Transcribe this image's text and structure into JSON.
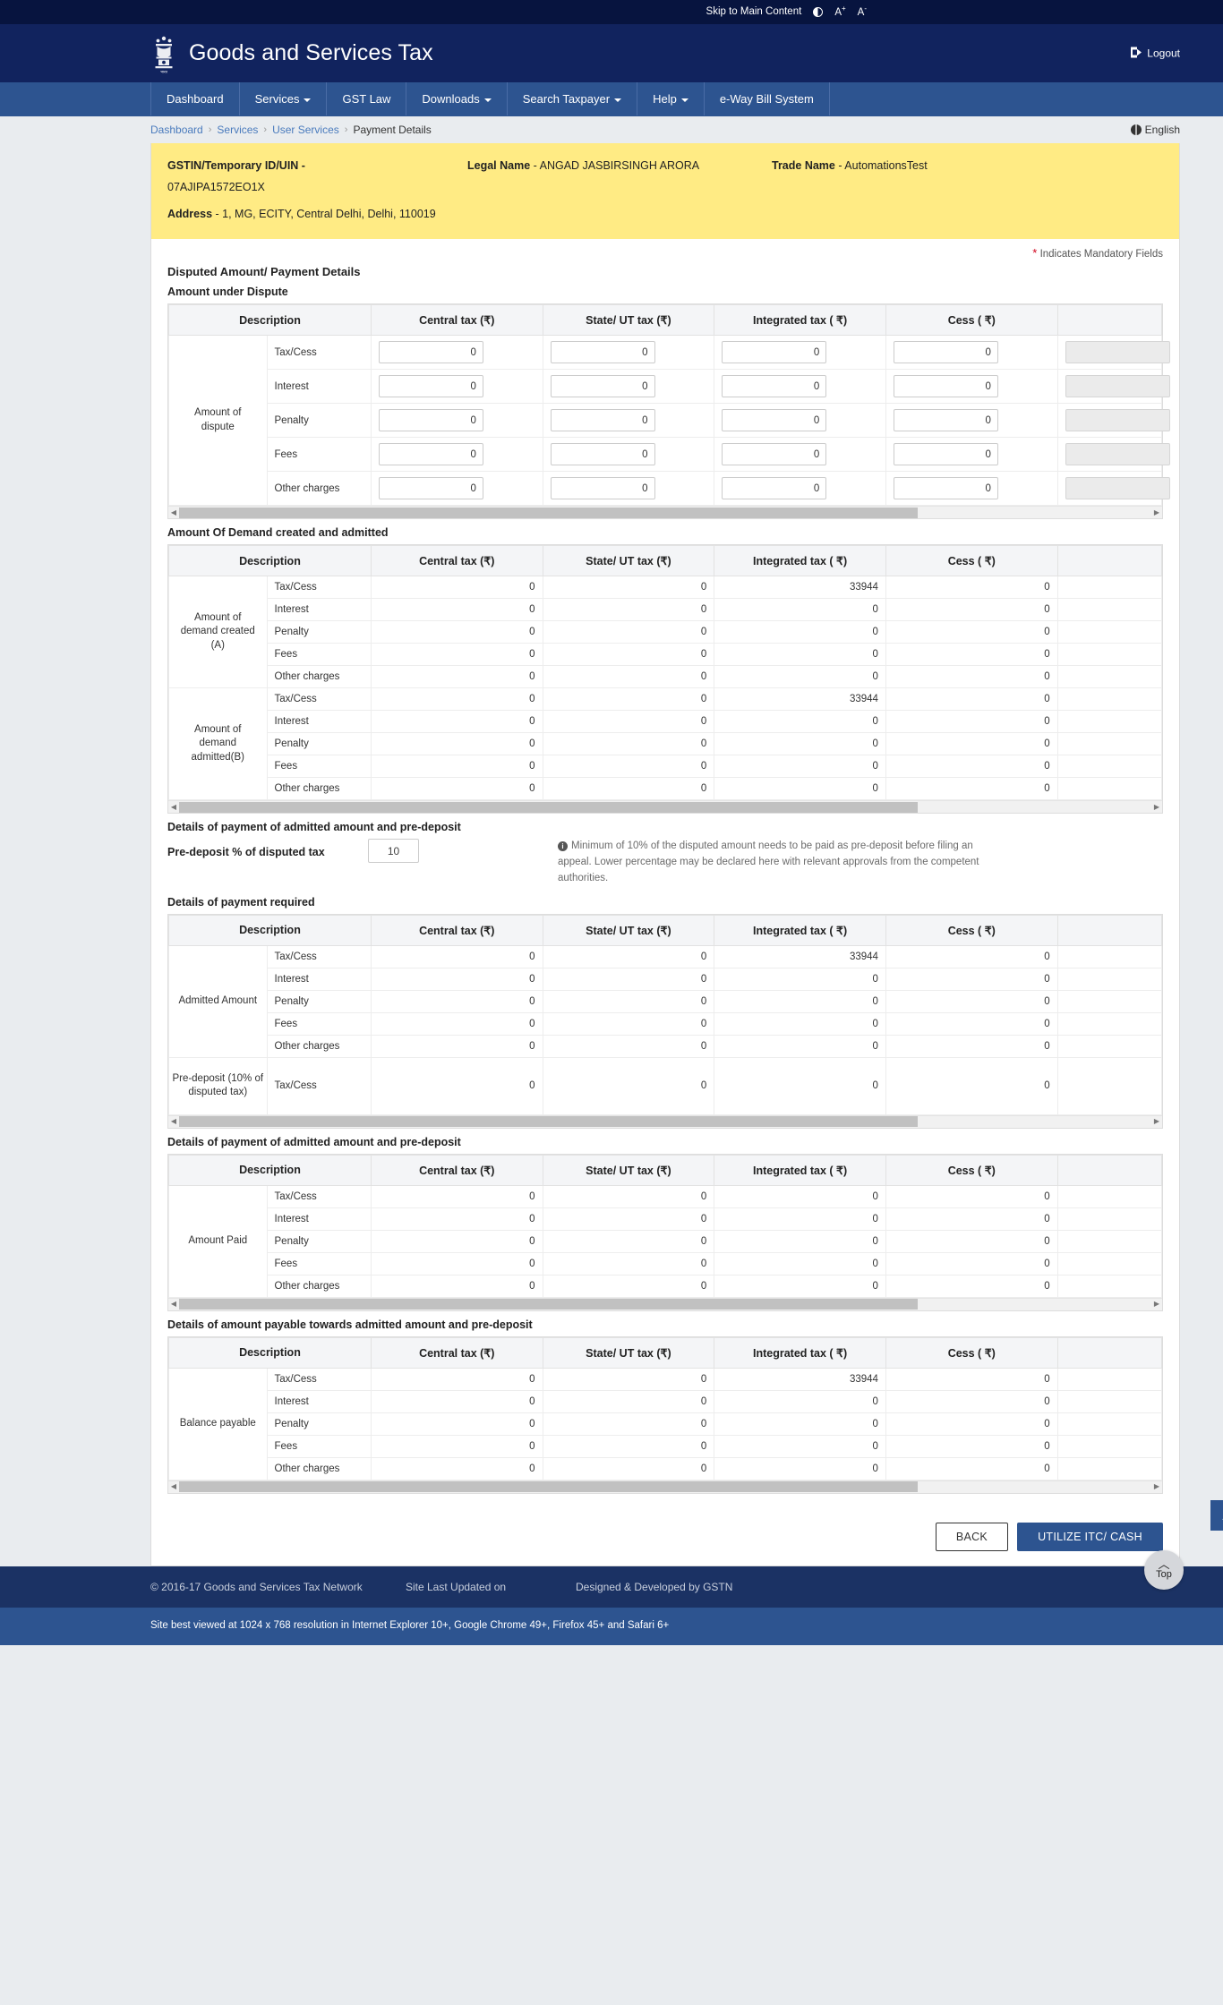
{
  "utilbar": {
    "skip": "Skip to Main Content",
    "contrast_icon": "contrast-icon",
    "font_increase": "A",
    "font_increase_sup": "+",
    "font_decrease": "A",
    "font_decrease_sup": "-"
  },
  "header": {
    "title": "Goods and Services Tax",
    "logout": "Logout",
    "emblem_icon": "india-emblem-icon"
  },
  "nav": {
    "items": [
      {
        "label": "Dashboard",
        "has_caret": false
      },
      {
        "label": "Services",
        "has_caret": true
      },
      {
        "label": "GST Law",
        "has_caret": false
      },
      {
        "label": "Downloads",
        "has_caret": true
      },
      {
        "label": "Search Taxpayer",
        "has_caret": true
      },
      {
        "label": "Help",
        "has_caret": true
      },
      {
        "label": "e-Way Bill System",
        "has_caret": false
      }
    ]
  },
  "breadcrumb": {
    "items": [
      "Dashboard",
      "Services",
      "User Services",
      "Payment Details"
    ],
    "separator": "›",
    "language": "English"
  },
  "taxpayer": {
    "gstin_label": "GSTIN/Temporary ID/UIN -",
    "gstin_value": "07AJIPA1572EO1X",
    "legal_name_label": "Legal Name",
    "legal_name_value": "- ANGAD JASBIRSINGH ARORA",
    "trade_name_label": "Trade Name",
    "trade_name_value": "- AutomationsTest",
    "address_label": "Address",
    "address_value": "- 1, MG, ECITY, Central Delhi, Delhi, 110019"
  },
  "mandatory_note": "Indicates Mandatory Fields",
  "page_title": "Disputed Amount/ Payment Details",
  "columns": [
    "Description",
    "Central tax (₹)",
    "State/ UT tax (₹)",
    "Integrated tax ( ₹)",
    "Cess ( ₹)",
    ""
  ],
  "row_labels": [
    "Tax/Cess",
    "Interest",
    "Penalty",
    "Fees",
    "Other charges"
  ],
  "table1": {
    "title": "Amount under Dispute",
    "group_label": "Amount of dispute",
    "editable": true,
    "rows": [
      {
        "label": "Tax/Cess",
        "values": [
          "0",
          "0",
          "0",
          "0"
        ]
      },
      {
        "label": "Interest",
        "values": [
          "0",
          "0",
          "0",
          "0"
        ]
      },
      {
        "label": "Penalty",
        "values": [
          "0",
          "0",
          "0",
          "0"
        ]
      },
      {
        "label": "Fees",
        "values": [
          "0",
          "0",
          "0",
          "0"
        ]
      },
      {
        "label": "Other charges",
        "values": [
          "0",
          "0",
          "0",
          "0"
        ]
      }
    ]
  },
  "table2": {
    "title": "Amount Of Demand created and admitted",
    "groups": [
      {
        "label": "Amount of demand created (A)",
        "rows": [
          {
            "label": "Tax/Cess",
            "values": [
              "0",
              "0",
              "33944",
              "0"
            ]
          },
          {
            "label": "Interest",
            "values": [
              "0",
              "0",
              "0",
              "0"
            ]
          },
          {
            "label": "Penalty",
            "values": [
              "0",
              "0",
              "0",
              "0"
            ]
          },
          {
            "label": "Fees",
            "values": [
              "0",
              "0",
              "0",
              "0"
            ]
          },
          {
            "label": "Other charges",
            "values": [
              "0",
              "0",
              "0",
              "0"
            ]
          }
        ]
      },
      {
        "label": "Amount of demand admitted(B)",
        "rows": [
          {
            "label": "Tax/Cess",
            "values": [
              "0",
              "0",
              "33944",
              "0"
            ]
          },
          {
            "label": "Interest",
            "values": [
              "0",
              "0",
              "0",
              "0"
            ]
          },
          {
            "label": "Penalty",
            "values": [
              "0",
              "0",
              "0",
              "0"
            ]
          },
          {
            "label": "Fees",
            "values": [
              "0",
              "0",
              "0",
              "0"
            ]
          },
          {
            "label": "Other charges",
            "values": [
              "0",
              "0",
              "0",
              "0"
            ]
          }
        ]
      }
    ]
  },
  "predeposit": {
    "section_title": "Details of payment of admitted amount and pre-deposit",
    "label": "Pre-deposit % of disputed tax",
    "value": "10",
    "note": "Minimum of 10% of the disputed amount needs to be paid as pre-deposit before filing an appeal. Lower percentage may be declared here with relevant approvals from the competent authorities."
  },
  "table3": {
    "title": "Details of payment required",
    "groups": [
      {
        "label": "Admitted Amount",
        "rows": [
          {
            "label": "Tax/Cess",
            "values": [
              "0",
              "0",
              "33944",
              "0"
            ]
          },
          {
            "label": "Interest",
            "values": [
              "0",
              "0",
              "0",
              "0"
            ]
          },
          {
            "label": "Penalty",
            "values": [
              "0",
              "0",
              "0",
              "0"
            ]
          },
          {
            "label": "Fees",
            "values": [
              "0",
              "0",
              "0",
              "0"
            ]
          },
          {
            "label": "Other charges",
            "values": [
              "0",
              "0",
              "0",
              "0"
            ]
          }
        ]
      },
      {
        "label": "Pre-deposit (10% of disputed tax)",
        "rows": [
          {
            "label": "Tax/Cess",
            "values": [
              "0",
              "0",
              "0",
              "0"
            ]
          }
        ]
      }
    ]
  },
  "table4": {
    "title": "Details of payment of admitted amount and pre-deposit",
    "groups": [
      {
        "label": "Amount Paid",
        "rows": [
          {
            "label": "Tax/Cess",
            "values": [
              "0",
              "0",
              "0",
              "0"
            ]
          },
          {
            "label": "Interest",
            "values": [
              "0",
              "0",
              "0",
              "0"
            ]
          },
          {
            "label": "Penalty",
            "values": [
              "0",
              "0",
              "0",
              "0"
            ]
          },
          {
            "label": "Fees",
            "values": [
              "0",
              "0",
              "0",
              "0"
            ]
          },
          {
            "label": "Other charges",
            "values": [
              "0",
              "0",
              "0",
              "0"
            ]
          }
        ]
      }
    ]
  },
  "table5": {
    "title": "Details of amount payable towards admitted amount and pre-deposit",
    "groups": [
      {
        "label": "Balance payable",
        "rows": [
          {
            "label": "Tax/Cess",
            "values": [
              "0",
              "0",
              "33944",
              "0"
            ]
          },
          {
            "label": "Interest",
            "values": [
              "0",
              "0",
              "0",
              "0"
            ]
          },
          {
            "label": "Penalty",
            "values": [
              "0",
              "0",
              "0",
              "0"
            ]
          },
          {
            "label": "Fees",
            "values": [
              "0",
              "0",
              "0",
              "0"
            ]
          },
          {
            "label": "Other charges",
            "values": [
              "0",
              "0",
              "0",
              "0"
            ]
          }
        ]
      }
    ]
  },
  "actions": {
    "back": "BACK",
    "utilize": "UTILIZE ITC/ CASH"
  },
  "footer": {
    "copyright": "© 2016-17 Goods and Services Tax Network",
    "updated": "Site Last Updated on",
    "designed": "Designed & Developed by GSTN",
    "browsers": "Site best viewed at 1024 x 768 resolution in Internet Explorer 10+, Google Chrome 49+, Firefox 45+ and Safari 6+",
    "top_label": "Top"
  },
  "colors": {
    "header_blue": "#11235e",
    "nav_blue": "#2d5490",
    "util_blue": "#07143f",
    "banner_yellow": "#ffeb84",
    "mandatory_red": "#d0021b",
    "page_bg": "#e9ecef"
  }
}
